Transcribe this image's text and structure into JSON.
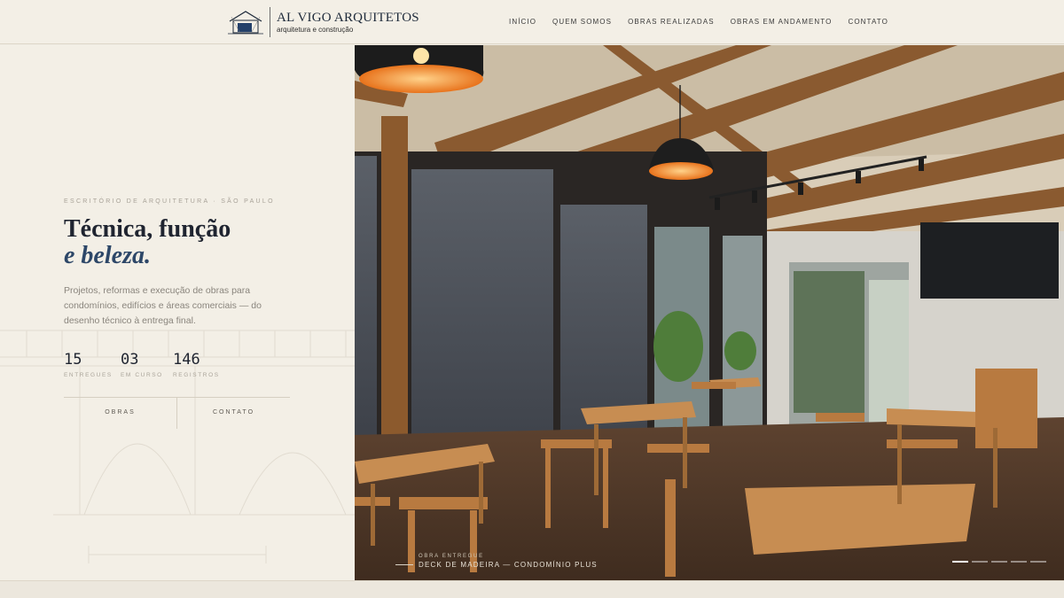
{
  "brand": {
    "name": "AL VIGO ARQUITETOS",
    "tagline": "arquitetura e construção"
  },
  "nav": {
    "items": [
      {
        "label": "INÍCIO"
      },
      {
        "label": "QUEM SOMOS"
      },
      {
        "label": "OBRAS REALIZADAS"
      },
      {
        "label": "OBRAS EM ANDAMENTO"
      },
      {
        "label": "CONTATO"
      }
    ]
  },
  "hero": {
    "eyebrow": "ESCRITÓRIO DE ARQUITETURA · SÃO PAULO",
    "headline_line1": "Técnica, função",
    "headline_line2": "e beleza.",
    "description": "Projetos, reformas e execução de obras para condomínios, edifícios e áreas comerciais — do desenho técnico à entrega final.",
    "stats": [
      {
        "value": "15",
        "label": "ENTREGUES"
      },
      {
        "value": "03",
        "label": "EM CURSO"
      },
      {
        "value": "146",
        "label": "REGISTROS"
      }
    ],
    "cta_primary": "OBRAS",
    "cta_secondary": "CONTATO"
  },
  "slide": {
    "kicker": "OBRA ENTREGUE",
    "title": "DECK DE MADEIRA — CONDOMÍNIO PLUS",
    "slide_count": 5,
    "active_slide": 1
  },
  "colors": {
    "background": "#f3efe6",
    "navy_accent": "#2d4768",
    "wood": "#b9834a"
  }
}
